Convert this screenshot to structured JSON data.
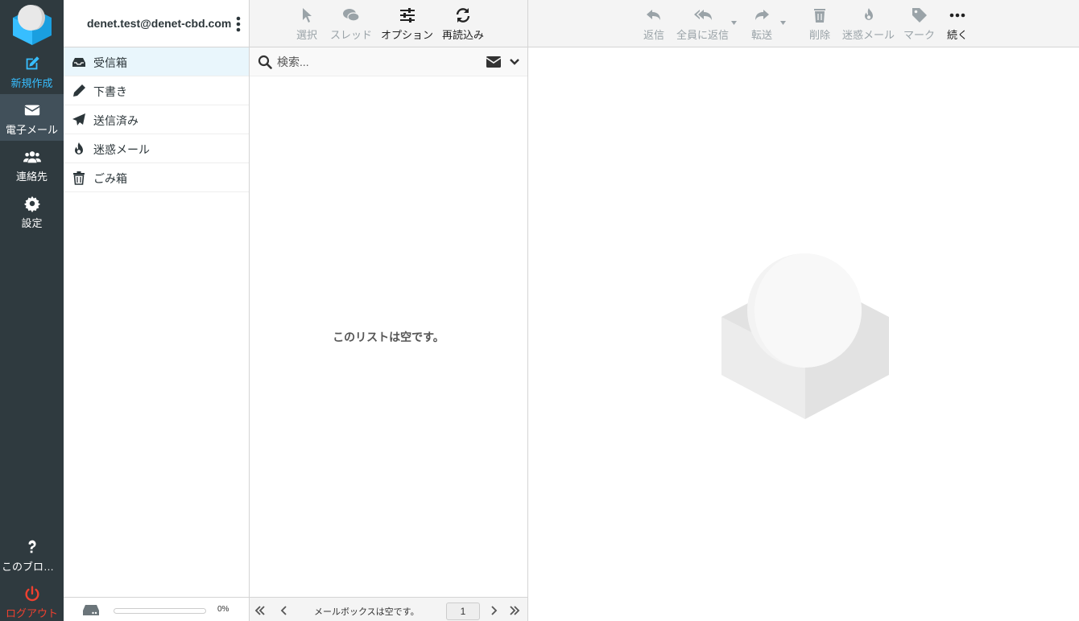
{
  "nav": {
    "compose": "新規作成",
    "mail": "電子メール",
    "contacts": "連絡先",
    "settings": "設定",
    "about": "このブログ...",
    "logout": "ログアウト"
  },
  "account": {
    "email": "denet.test@denet-cbd.com"
  },
  "folders": [
    {
      "label": "受信箱",
      "icon": "inbox-icon"
    },
    {
      "label": "下書き",
      "icon": "pencil-icon"
    },
    {
      "label": "送信済み",
      "icon": "paper-plane-icon"
    },
    {
      "label": "迷惑メール",
      "icon": "fire-icon"
    },
    {
      "label": "ごみ箱",
      "icon": "trash-icon"
    }
  ],
  "quota": {
    "percent": 0,
    "label": "0%"
  },
  "list_toolbar": {
    "select": "選択",
    "threads": "スレッド",
    "options": "オプション",
    "refresh": "再読込み"
  },
  "search": {
    "placeholder": "検索..."
  },
  "list": {
    "empty": "このリストは空です。"
  },
  "pagination": {
    "status": "メールボックスは空です。",
    "page": "1"
  },
  "content_toolbar": {
    "reply": "返信",
    "reply_all": "全員に返信",
    "forward": "転送",
    "delete": "削除",
    "junk": "迷惑メール",
    "mark": "マーク",
    "more": "続く"
  },
  "colors": {
    "nav_bg": "#2f3a3f",
    "nav_selected": "#41505a",
    "accent": "#37beff",
    "logout": "#f0402f",
    "selected_folder": "#e9f6fc"
  }
}
